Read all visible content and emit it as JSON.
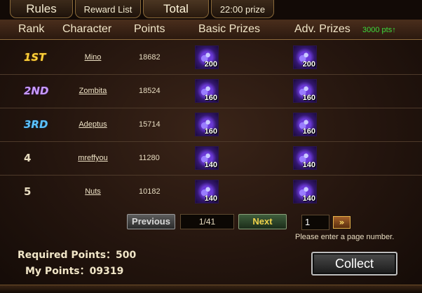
{
  "tabs": [
    {
      "label": "Rules",
      "active": false
    },
    {
      "label": "Reward List",
      "active": false
    },
    {
      "label": "Total",
      "active": true
    },
    {
      "label": "22:00 prize",
      "active": false
    }
  ],
  "header": {
    "rank": "Rank",
    "character": "Character",
    "points": "Points",
    "basic_prizes": "Basic Prizes",
    "adv_prizes": "Adv. Prizes",
    "adv_note": "3000 pts↑"
  },
  "rows": [
    {
      "rank": "1ST",
      "character": "Mino",
      "points": "18682",
      "basic_qty": "200",
      "adv_qty": "200"
    },
    {
      "rank": "2ND",
      "character": "Zombita",
      "points": "18524",
      "basic_qty": "160",
      "adv_qty": "160"
    },
    {
      "rank": "3RD",
      "character": "Adeptus",
      "points": "15714",
      "basic_qty": "160",
      "adv_qty": "160"
    },
    {
      "rank": "4",
      "character": "mreffyou",
      "points": "11280",
      "basic_qty": "140",
      "adv_qty": "140"
    },
    {
      "rank": "5",
      "character": "Nuts",
      "points": "10182",
      "basic_qty": "140",
      "adv_qty": "140"
    }
  ],
  "pager": {
    "previous": "Previous",
    "page": "1/41",
    "next": "Next",
    "goto_value": "1",
    "goto_icon": "double-chevron-right-icon",
    "hint": "Please enter a page number."
  },
  "footer": {
    "required_label": "Required Points：500",
    "my_points_label": "My Points：09319",
    "collect": "Collect"
  },
  "icons": {
    "prize": "purple-crystal-icon"
  },
  "colors": {
    "accent_green": "#3ddc3d",
    "gold": "#ffd23a"
  }
}
